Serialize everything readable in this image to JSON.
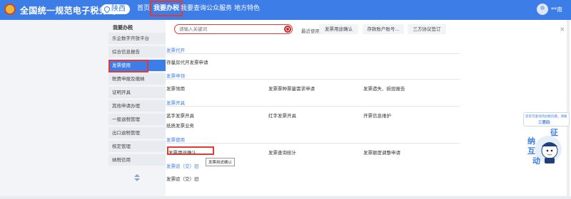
{
  "header": {
    "site_title": "全国统一规范电子税务局",
    "region": "陕西",
    "nav": [
      "首页",
      "我要办税",
      "我要查询",
      "公众服务",
      "地方特色"
    ],
    "active_nav": "我要办税",
    "user_name": "**南"
  },
  "sidebar": {
    "heading": "我要办税",
    "items": [
      "乐企数字开放平台",
      "综合信息报告",
      "发票使用",
      "税费申报及缴纳",
      "证明开具",
      "其他申请办理",
      "一般退税管理",
      "出口退税管理",
      "核定管理",
      "纳税信用"
    ],
    "active_item": "发票使用"
  },
  "search": {
    "placeholder": "请输入关键词",
    "recent_label": "最近使用:",
    "recent_items": [
      "发票用途确认",
      "存款账户账号...",
      "三方协议签订"
    ],
    "close_symbol": "×"
  },
  "sections": [
    {
      "title": "发票代开",
      "links": [
        "存量房代开发票申请"
      ]
    },
    {
      "title": "发票申领",
      "links": [
        "发票领用",
        "发票票种票量需求申请",
        "发票遗失、损毁报告"
      ]
    },
    {
      "title": "发票开具",
      "links": [
        "蓝字发票开具",
        "红字发票开具",
        "开票信息维护",
        "纸质发票业务"
      ]
    },
    {
      "title": "发票使用",
      "links": [
        "发票用途确认",
        "发票查询统计",
        "发票额度调整申请"
      ]
    },
    {
      "title": "发票验（交）旧",
      "links": [
        "发票验（交）旧"
      ]
    }
  ],
  "tooltip": "发票用途确认",
  "assistant": {
    "bubble_line1": "您有可查询的办税问题，请拨",
    "bubble_line2": "三思码",
    "figure_chars": [
      "征",
      "纳",
      "互",
      "动"
    ]
  },
  "colors": {
    "primary": "#3d7de8",
    "highlight_box": "#e53935"
  }
}
